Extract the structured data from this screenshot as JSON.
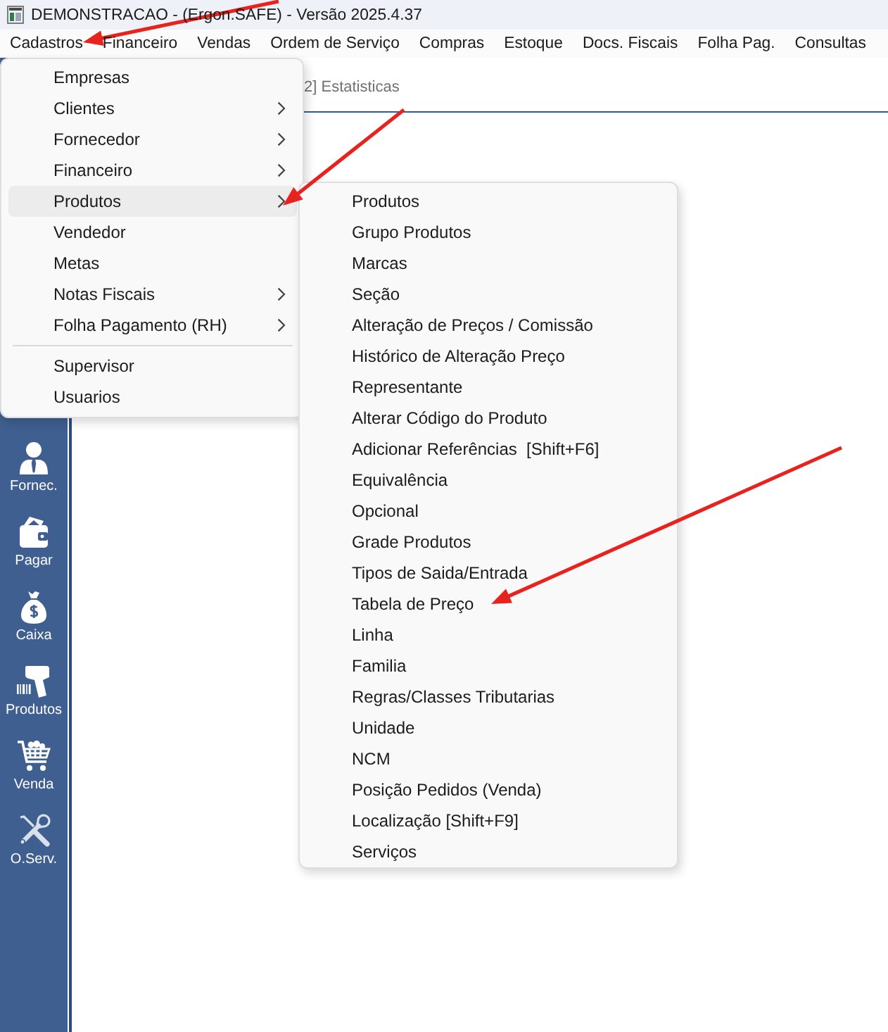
{
  "window": {
    "title": "DEMONSTRACAO - (Ergon.SAFE) - Versão 2025.4.37"
  },
  "menu_bar": {
    "items": [
      "Cadastros",
      "Financeiro",
      "Vendas",
      "Ordem de Serviço",
      "Compras",
      "Estoque",
      "Docs. Fiscais",
      "Folha Pag.",
      "Consultas"
    ]
  },
  "tab_bar": {
    "tabs": [
      {
        "label": "2] Estatisticas"
      }
    ]
  },
  "sidebar": {
    "items": [
      {
        "label": "Fornec."
      },
      {
        "label": "Pagar"
      },
      {
        "label": "Caixa"
      },
      {
        "label": "Produtos"
      },
      {
        "label": "Venda"
      },
      {
        "label": "O.Serv."
      }
    ]
  },
  "cadastros_menu": {
    "sections": [
      {
        "items": [
          {
            "label": "Empresas",
            "submenu": false,
            "selected": false
          },
          {
            "label": "Clientes",
            "submenu": true,
            "selected": false
          },
          {
            "label": "Fornecedor",
            "submenu": true,
            "selected": false
          },
          {
            "label": "Financeiro",
            "submenu": true,
            "selected": false
          },
          {
            "label": "Produtos",
            "submenu": true,
            "selected": true
          },
          {
            "label": "Vendedor",
            "submenu": false,
            "selected": false
          },
          {
            "label": "Metas",
            "submenu": false,
            "selected": false
          },
          {
            "label": "Notas Fiscais",
            "submenu": true,
            "selected": false
          },
          {
            "label": "Folha Pagamento (RH)",
            "submenu": true,
            "selected": false
          }
        ]
      },
      {
        "items": [
          {
            "label": "Supervisor",
            "submenu": false,
            "selected": false
          },
          {
            "label": "Usuarios",
            "submenu": false,
            "selected": false
          }
        ]
      }
    ]
  },
  "produtos_submenu": {
    "items": [
      {
        "label": "Produtos",
        "selected": false
      },
      {
        "label": "Grupo Produtos",
        "selected": false
      },
      {
        "label": "Marcas",
        "selected": false
      },
      {
        "label": "Seção",
        "selected": false
      },
      {
        "label": "Alteração de Preços / Comissão",
        "selected": false
      },
      {
        "label": "Histórico de Alteração Preço",
        "selected": false
      },
      {
        "label": "Representante",
        "selected": false
      },
      {
        "label": "Alterar Código do Produto",
        "selected": false
      },
      {
        "label": "Adicionar Referências  [Shift+F6]",
        "selected": false
      },
      {
        "label": "Equivalência",
        "selected": false
      },
      {
        "label": "Opcional",
        "selected": false
      },
      {
        "label": "Grade Produtos",
        "selected": false
      },
      {
        "label": "Tipos de Saida/Entrada",
        "selected": false
      },
      {
        "label": "Tabela de Preço",
        "selected": false
      },
      {
        "label": "Linha",
        "selected": false
      },
      {
        "label": "Familia",
        "selected": false
      },
      {
        "label": "Regras/Classes Tributarias",
        "selected": false
      },
      {
        "label": "Unidade",
        "selected": false
      },
      {
        "label": "NCM",
        "selected": false
      },
      {
        "label": "Posição Pedidos (Venda)",
        "selected": false
      },
      {
        "label": "Localização [Shift+F9]",
        "selected": false
      },
      {
        "label": "Serviços",
        "selected": false
      }
    ]
  }
}
